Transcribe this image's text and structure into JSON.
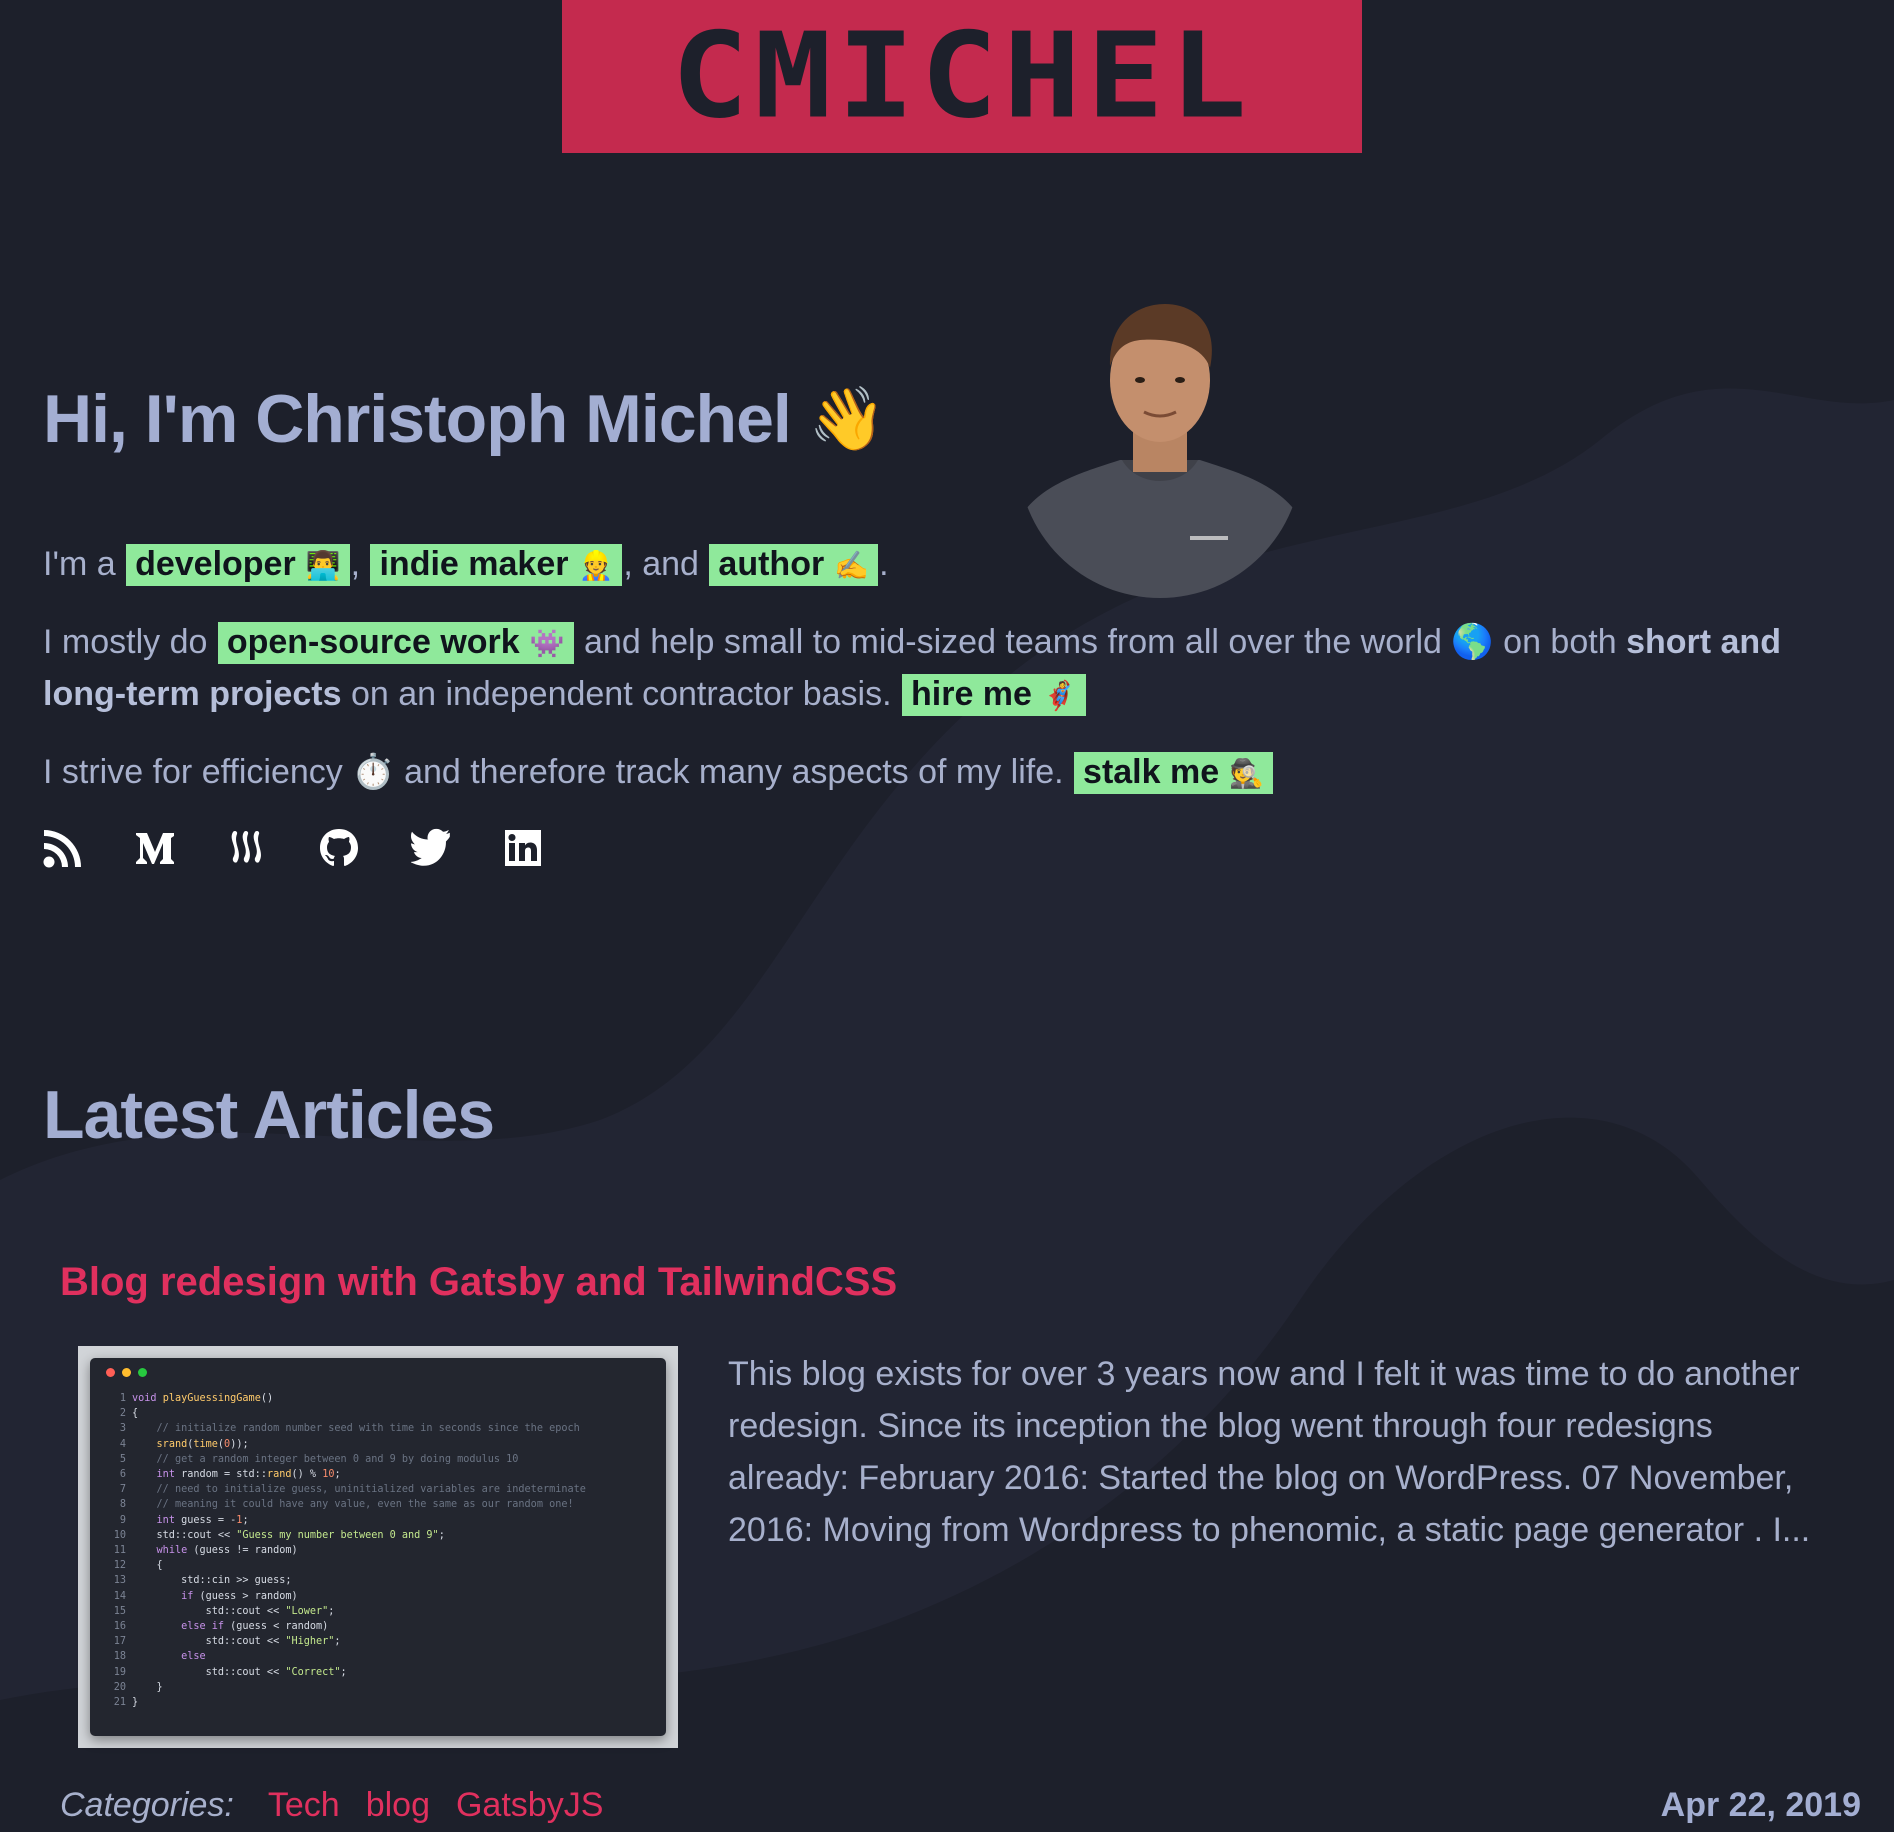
{
  "logo": {
    "text": "CMICHEL"
  },
  "hero": {
    "greeting": "Hi, I'm Christoph Michel",
    "wave_emoji": "👋",
    "line1": {
      "prefix": "I'm a",
      "sep1": ",",
      "sep2": ", and",
      "end": ".",
      "developer": {
        "label": "developer",
        "emoji": "👨‍💻"
      },
      "maker": {
        "label": "indie maker",
        "emoji": "👷"
      },
      "author": {
        "label": "author",
        "emoji": "✍️"
      }
    },
    "line2": {
      "prefix": "I mostly do",
      "oss": {
        "label": "open-source work",
        "emoji": "👾"
      },
      "middle": "and help small to mid-sized teams from all over the world",
      "globe_emoji": "🌎",
      "on_both": "on both",
      "strong": "short and",
      "strong2": "long-term projects",
      "suffix": "on an independent contractor basis.",
      "hire": {
        "label": "hire me",
        "emoji": "🦸"
      }
    },
    "line3": {
      "prefix": "I strive for efficiency",
      "timer_emoji": "⏱️",
      "suffix": "and therefore track many aspects of my life.",
      "stalk": {
        "label": "stalk me",
        "emoji": "🕵️"
      }
    }
  },
  "social": {
    "icons": [
      "rss-icon",
      "medium-icon",
      "steemit-icon",
      "github-icon",
      "twitter-icon",
      "linkedin-icon"
    ]
  },
  "articles": {
    "heading": "Latest Articles",
    "items": [
      {
        "title": "Blog redesign with Gatsby and TailwindCSS",
        "excerpt": "This blog exists for over 3 years now and I felt it was time to do another redesign. Since its inception the blog went through four redesigns already: February 2016: Started the blog on WordPress. 07 November, 2016: Moving from Wordpress to phenomic, a static page generator . I...",
        "categories_label": "Categories:",
        "categories": [
          "Tech",
          "blog",
          "GatsbyJS"
        ],
        "date": "Apr 22, 2019"
      }
    ]
  },
  "colors": {
    "background": "#1d202b",
    "logo_bg": "#c42a4e",
    "highlight": "#8fe99b",
    "accent": "#e0305e",
    "text": "#a7b0cc"
  }
}
